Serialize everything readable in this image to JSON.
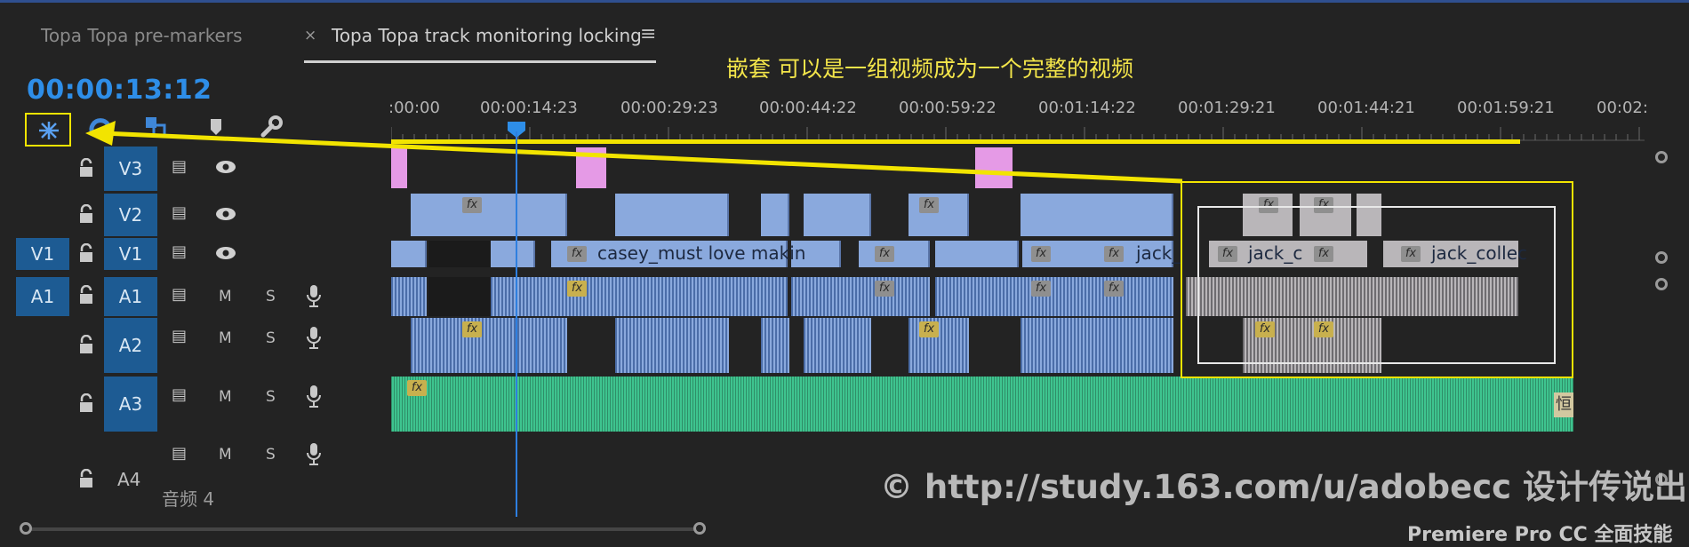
{
  "tabs": [
    {
      "label": "Topa Topa pre-markers"
    },
    {
      "label": "Topa Topa track monitoring locking",
      "close": "×",
      "menu": "≡"
    }
  ],
  "timecode": "00:00:13:12",
  "annotation": "嵌套 可以是一组视频成为一个完整的视频",
  "ruler_ticks": [
    ":00:00",
    "00:00:14:23",
    "00:00:29:23",
    "00:00:44:22",
    "00:00:59:22",
    "00:01:14:22",
    "00:01:29:21",
    "00:01:44:21",
    "00:01:59:21",
    "00:02:"
  ],
  "tracks": {
    "v3": {
      "name": "V3"
    },
    "v2": {
      "name": "V2"
    },
    "v1": {
      "name": "V1",
      "source": "V1"
    },
    "a1": {
      "name": "A1",
      "source": "A1",
      "m": "M",
      "s": "S"
    },
    "a2": {
      "name": "A2",
      "m": "M",
      "s": "S"
    },
    "a3": {
      "name": "A3",
      "m": "M",
      "s": "S"
    },
    "a4": {
      "name": "A4",
      "m": "M",
      "s": "S",
      "sub": "音频 4"
    }
  },
  "clips": {
    "casey": "casey_must love makin",
    "jack1": "jack_",
    "jack2": "jack_c",
    "jack3": "jack_collec",
    "a3_end": "恒",
    "fx": "fx"
  },
  "watermark": "© http://study.163.com/u/adobecc  设计传说出品",
  "watermark2": "Premiere Pro CC 全面技能",
  "colors": {
    "accent": "#2e8ee8",
    "highlight": "#f2e400",
    "video_clip": "#8aa9dd",
    "audio_music": "#3ec48f"
  },
  "icons": [
    "nest-icon",
    "snap-icon",
    "linked-selection-icon",
    "marker-icon",
    "wrench-icon",
    "lock-icon",
    "sync-icon",
    "eye-icon",
    "mic-icon"
  ]
}
